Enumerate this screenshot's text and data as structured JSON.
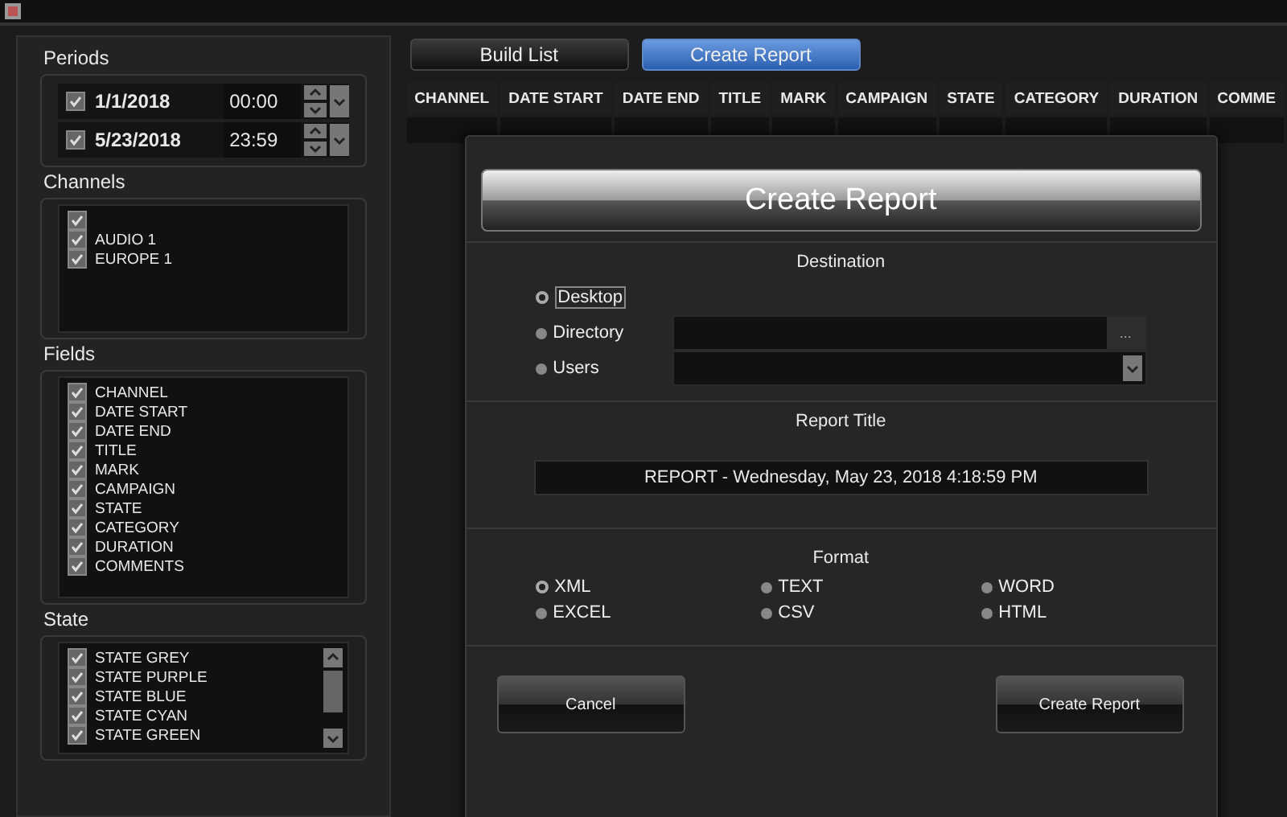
{
  "periods": {
    "title": "Periods",
    "items": [
      {
        "checked": true,
        "date": "1/1/2018",
        "time": "00:00"
      },
      {
        "checked": true,
        "date": "5/23/2018",
        "time": "23:59"
      }
    ]
  },
  "channels": {
    "title": "Channels",
    "items": [
      {
        "checked": true
      },
      {
        "checked": true,
        "label": "AUDIO 1"
      },
      {
        "checked": true,
        "label": "EUROPE 1"
      }
    ]
  },
  "fields": {
    "title": "Fields",
    "items": [
      {
        "checked": true,
        "label": "CHANNEL"
      },
      {
        "checked": true,
        "label": "DATE START"
      },
      {
        "checked": true,
        "label": "DATE END"
      },
      {
        "checked": true,
        "label": "TITLE"
      },
      {
        "checked": true,
        "label": "MARK"
      },
      {
        "checked": true,
        "label": "CAMPAIGN"
      },
      {
        "checked": true,
        "label": "STATE"
      },
      {
        "checked": true,
        "label": "CATEGORY"
      },
      {
        "checked": true,
        "label": "DURATION"
      },
      {
        "checked": true,
        "label": "COMMENTS"
      }
    ]
  },
  "state": {
    "title": "State",
    "items": [
      {
        "checked": true,
        "label": "STATE GREY"
      },
      {
        "checked": true,
        "label": "STATE PURPLE"
      },
      {
        "checked": true,
        "label": "STATE BLUE"
      },
      {
        "checked": true,
        "label": "STATE CYAN"
      },
      {
        "checked": true,
        "label": "STATE GREEN"
      }
    ]
  },
  "tabs": [
    {
      "label": "Build List",
      "selected": false
    },
    {
      "label": "Create Report",
      "selected": true
    }
  ],
  "table": {
    "columns": [
      "CHANNEL",
      "DATE START",
      "DATE END",
      "TITLE",
      "MARK",
      "CAMPAIGN",
      "STATE",
      "CATEGORY",
      "DURATION",
      "COMME"
    ]
  },
  "dialog": {
    "title": "Create Report",
    "destination": {
      "title": "Destination",
      "options": [
        {
          "label": "Desktop",
          "selected": true,
          "kind": "plain"
        },
        {
          "label": "Directory",
          "selected": false,
          "kind": "browse",
          "button": "..."
        },
        {
          "label": "Users",
          "selected": false,
          "kind": "dropdown"
        }
      ]
    },
    "report_title": {
      "title": "Report Title",
      "value": "REPORT - Wednesday, May 23, 2018 4:18:59 PM"
    },
    "format": {
      "title": "Format",
      "options": [
        {
          "label": "XML",
          "selected": true
        },
        {
          "label": "TEXT",
          "selected": false
        },
        {
          "label": "WORD",
          "selected": false
        },
        {
          "label": "EXCEL",
          "selected": false
        },
        {
          "label": "CSV",
          "selected": false
        },
        {
          "label": "HTML",
          "selected": false
        }
      ]
    },
    "buttons": [
      "Cancel",
      "Create Report"
    ]
  }
}
